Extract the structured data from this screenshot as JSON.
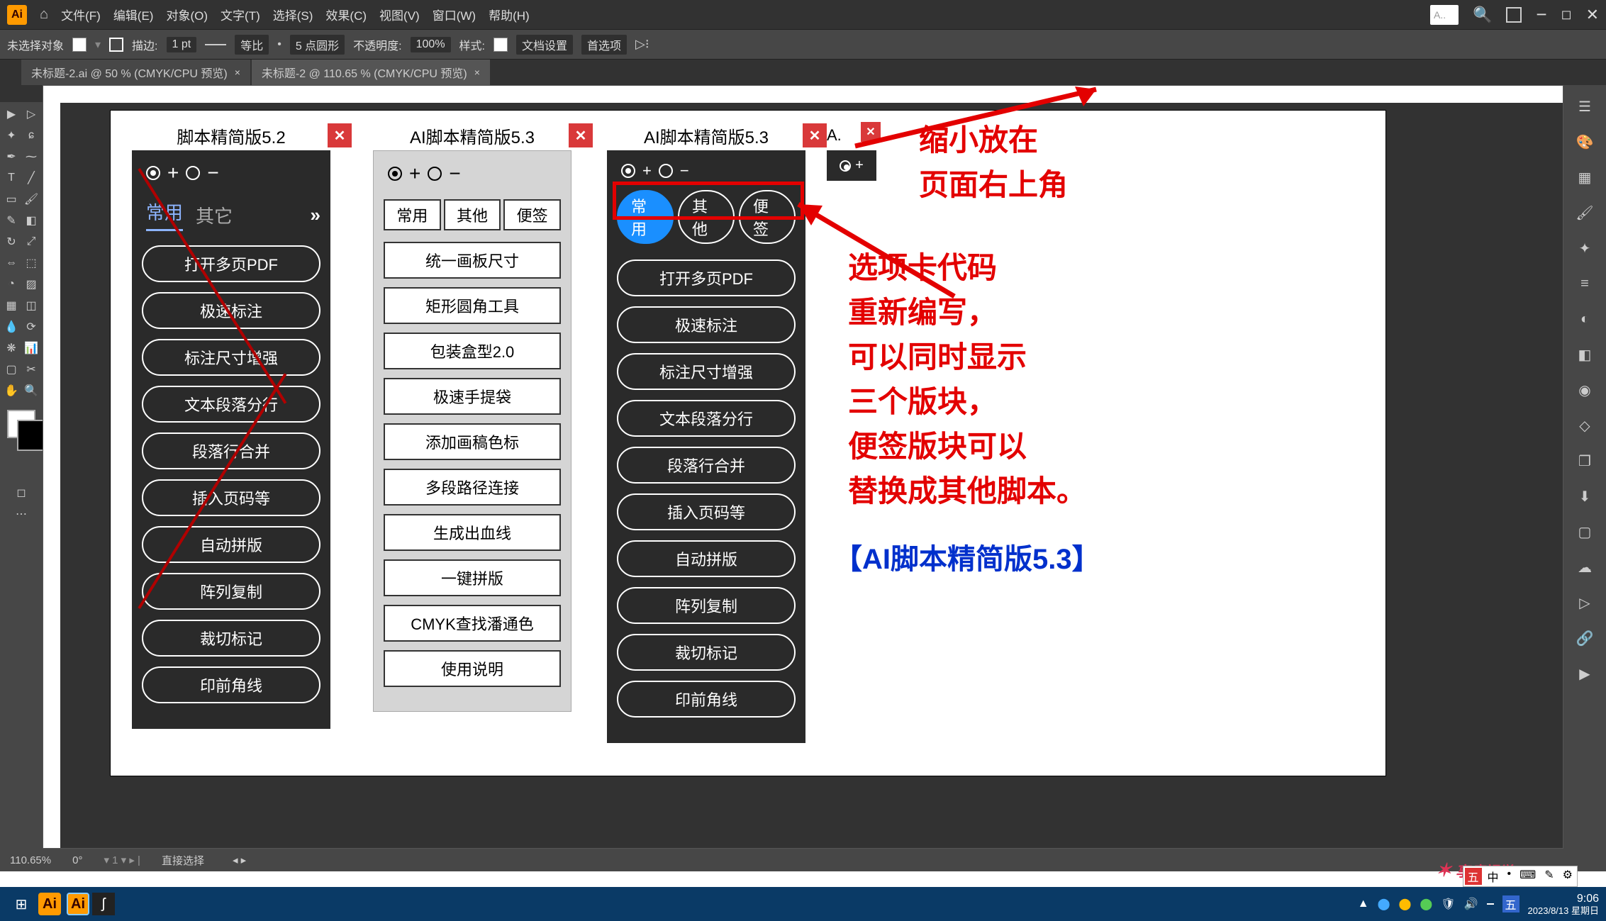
{
  "menu": {
    "file": "文件(F)",
    "edit": "编辑(E)",
    "object": "对象(O)",
    "type": "文字(T)",
    "select": "选择(S)",
    "effect": "效果(C)",
    "view": "视图(V)",
    "window": "窗口(W)",
    "help": "帮助(H)",
    "search_ph": "A.."
  },
  "ctrl": {
    "noSelect": "未选择对象",
    "stroke": "描边:",
    "pt": "1 pt",
    "uniform": "等比",
    "pt5": "5 点圆形",
    "opacity": "不透明度:",
    "pct": "100%",
    "style": "样式:",
    "docSetup": "文档设置",
    "prefs": "首选项"
  },
  "tabs": {
    "doc1": "未标题-2.ai @ 50 % (CMYK/CPU 预览)",
    "doc2": "未标题-2 @ 110.65 % (CMYK/CPU 预览)"
  },
  "status": {
    "zoom": "110.65%",
    "rot": "0°",
    "sel": "直接选择"
  },
  "panel52": {
    "title": "脚本精简版5.2",
    "tabs": {
      "a": "常用",
      "b": "其它"
    },
    "btns": [
      "打开多页PDF",
      "极速标注",
      "标注尺寸增强",
      "文本段落分行",
      "段落行合并",
      "插入页码等",
      "自动拼版",
      "阵列复制",
      "裁切标记",
      "印前角线"
    ]
  },
  "panel53light": {
    "title": "AI脚本精简版5.3",
    "tabs": {
      "a": "常用",
      "b": "其他",
      "c": "便签"
    },
    "btns": [
      "统一画板尺寸",
      "矩形圆角工具",
      "包装盒型2.0",
      "极速手提袋",
      "添加画稿色标",
      "多段路径连接",
      "生成出血线",
      "一键拼版",
      "CMYK查找潘通色",
      "使用说明"
    ]
  },
  "panel53dark": {
    "title": "AI脚本精简版5.3",
    "tabs": {
      "a": "常用",
      "b": "其他",
      "c": "便签"
    },
    "btns": [
      "打开多页PDF",
      "极速标注",
      "标注尺寸增强",
      "文本段落分行",
      "段落行合并",
      "插入页码等",
      "自动拼版",
      "阵列复制",
      "裁切标记",
      "印前角线"
    ]
  },
  "mini": {
    "title": "A."
  },
  "anno": {
    "t1": "缩小放在",
    "t2": "页面右上角",
    "t3": "选项卡代码",
    "t4": "重新编写，",
    "t5": "可以同时显示",
    "t6": "三个版块，",
    "t7": "便签版块可以",
    "t8": "替换成其他脚本。",
    "blue": "【AI脚本精简版5.3】"
  },
  "taskbar": {
    "time": "9:06",
    "date": "2023/8/13 星期日"
  },
  "watermark": "享瘦视觉",
  "ime": "中"
}
